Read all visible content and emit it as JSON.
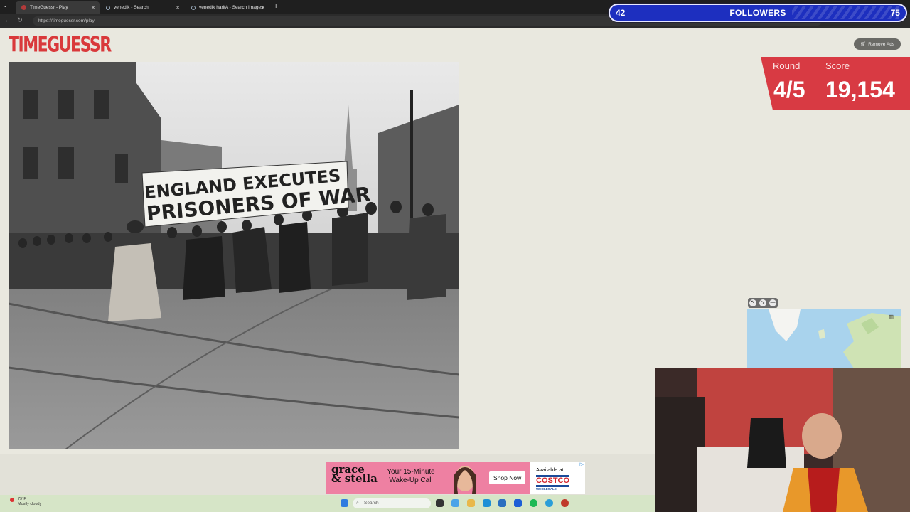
{
  "browser": {
    "tabs": [
      {
        "title": "TimeGuessr - Play",
        "active": true
      },
      {
        "title": "venedik - Search",
        "active": false
      },
      {
        "title": "venedik haritA - Search Images",
        "active": false
      }
    ],
    "url": "https://timeguessr.com/play"
  },
  "overlay": {
    "followers_left": "42",
    "followers_label": "FOLLOWERS",
    "followers_right": "75"
  },
  "page": {
    "logo": "TIMEGUESSR",
    "remove_ads_label": "Remove Ads",
    "photo": {
      "banner_line1": "ENGLAND EXECUTES",
      "banner_line2": "PRISONERS OF WAR"
    },
    "score_panel": {
      "round_label": "Round",
      "round_value": "4/5",
      "score_label": "Score",
      "score_value": "19,154"
    }
  },
  "ad": {
    "brand_line1": "grace",
    "brand_line2": "& stella",
    "tagline": "Your 15-Minute Wake-Up Call",
    "cta": "Shop Now",
    "available_at": "Available at",
    "retailer": "COSTCO",
    "retailer_sub": "WHOLESALE"
  },
  "taskbar": {
    "temperature": "79°F",
    "weather": "Mostly cloudy",
    "search_placeholder": "Search"
  }
}
